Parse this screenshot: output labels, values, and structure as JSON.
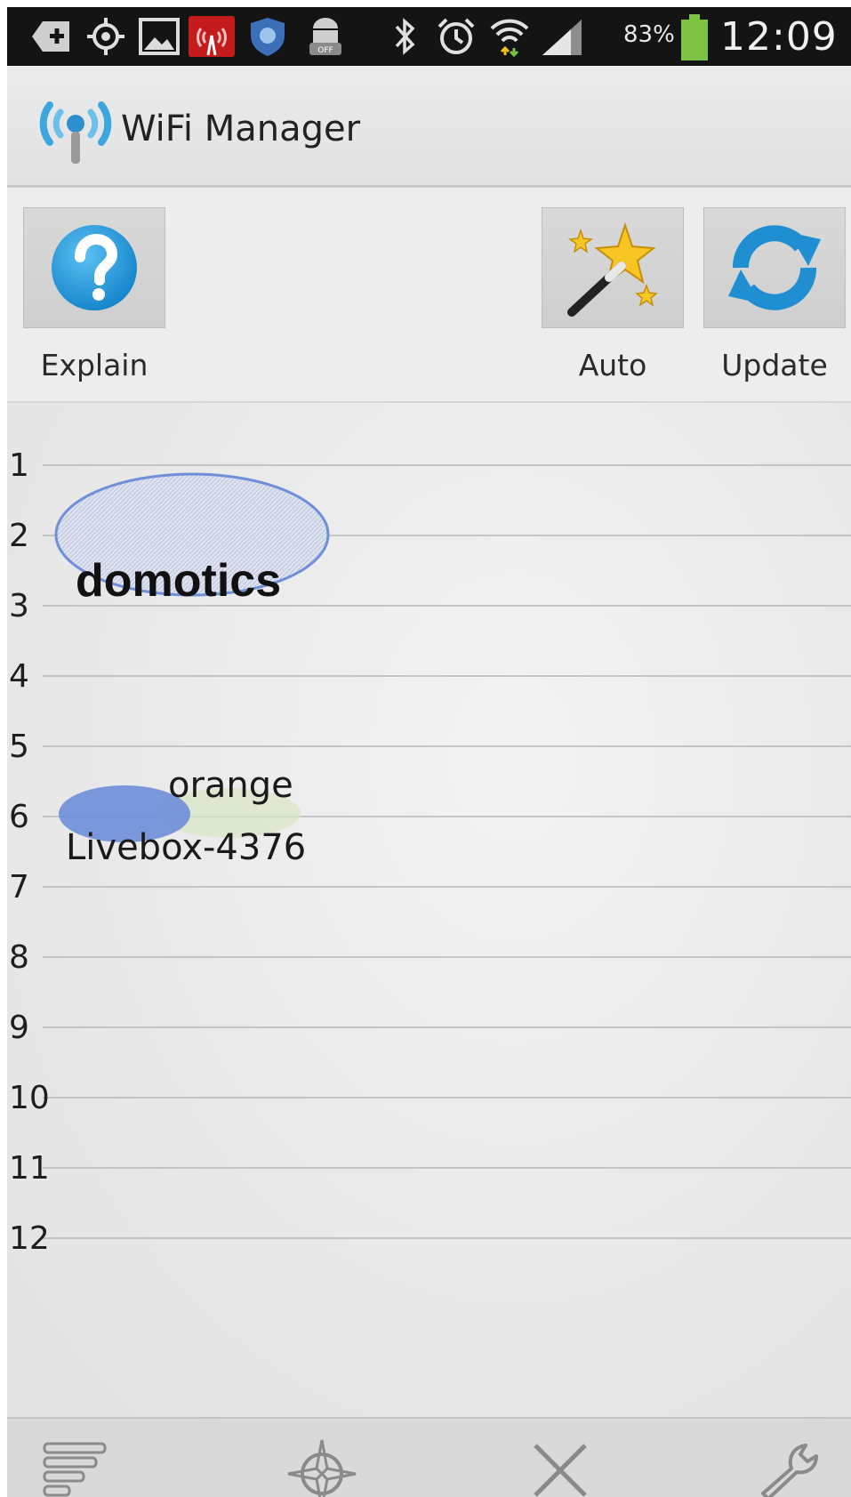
{
  "status_bar": {
    "battery_percent": "83%",
    "time": "12:09",
    "icons": [
      "add-icon",
      "gps-icon",
      "gallery-icon",
      "antenna-alert-icon",
      "shield-app-icon",
      "android-app-icon",
      "bluetooth-icon",
      "alarm-icon",
      "wifi-icon",
      "signal-icon",
      "battery-icon"
    ]
  },
  "action_bar": {
    "title": "WiFi Manager",
    "icon": "wifi-antenna-icon"
  },
  "toolbar": {
    "explain_label": "Explain",
    "auto_label": "Auto",
    "update_label": "Update"
  },
  "channel_graph": {
    "channels": [
      "1",
      "2",
      "3",
      "4",
      "5",
      "6",
      "7",
      "8",
      "9",
      "10",
      "11",
      "12"
    ],
    "networks": [
      {
        "ssid": "domotics",
        "channel": 2,
        "style": "bold",
        "color": "#6f8fd8"
      },
      {
        "ssid": "orange",
        "channel": 6,
        "style": "normal",
        "color": "#c8dca8"
      },
      {
        "ssid": "Livebox-4376",
        "channel": 6,
        "style": "normal",
        "color": "#6f8fd8"
      }
    ]
  },
  "bottom_bar": {
    "icons": [
      "sort-icon",
      "locate-icon",
      "close-icon",
      "settings-wrench-icon"
    ]
  },
  "colors": {
    "status_bar": "#141414",
    "action_bar": "#e6e6e6",
    "accent_blue": "#1e8fd0",
    "network_blue": "#6f8fd8"
  }
}
